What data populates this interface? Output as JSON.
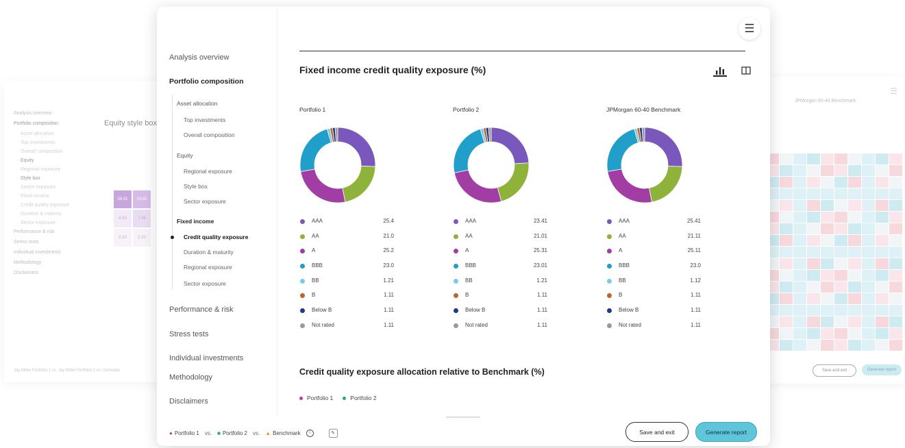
{
  "background_left": {
    "nav": [
      "Analysis overview",
      "Portfolio composition",
      "Asset allocation",
      "Top investments",
      "Overall composition",
      "Equity",
      "Regional exposure",
      "Style box",
      "Sector exposure",
      "Fixed income",
      "Credit quality exposure",
      "Duration & maturity",
      "Sector exposure",
      "Performance & risk",
      "Stress tests",
      "Individual investments",
      "Methodology",
      "Disclaimers"
    ],
    "title": "Equity style box",
    "cells": [
      "26.01",
      "24.92",
      "4.03",
      "7.34",
      "2.20",
      "2.20"
    ],
    "footer": "Jay Miller Portfolio 1  vs.  Jay Miller Portfolio 2  vs.  Generate"
  },
  "background_right": {
    "title": "JPMorgan 60-40 Benchmark",
    "save_label": "Save and exit",
    "generate_label": "Generate report"
  },
  "sidebar": {
    "analysis_overview": "Analysis overview",
    "portfolio_composition": "Portfolio composition",
    "asset_allocation": "Asset allocation",
    "top_investments": "Top investments",
    "overall_composition": "Overall composition",
    "equity": "Equity",
    "regional_exposure": "Regional exposure",
    "style_box": "Style box",
    "sector_exposure_eq": "Sector exposure",
    "fixed_income": "Fixed income",
    "credit_quality_exposure": "Credit quality exposure",
    "duration_maturity": "Duration & maturity",
    "regional_exposure_fi": "Regional exposure",
    "sector_exposure_fi": "Sector exposure",
    "performance_risk": "Performance & risk",
    "stress_tests": "Stress tests",
    "individual_investments": "Individual investments",
    "methodology": "Methodology",
    "disclaimers": "Disclaimers"
  },
  "header": {
    "menu_icon": "hamburger-icon"
  },
  "main": {
    "title": "Fixed income credit quality exposure (%)",
    "second_title": "Credit quality exposure allocation relative to Benchmark (%)",
    "series_legend": [
      {
        "label": "Portfolio 1",
        "color": "#c2399e"
      },
      {
        "label": "Portfolio 2",
        "color": "#17a989"
      }
    ]
  },
  "colors": {
    "AAA": "#7a57bd",
    "AA": "#8fb23a",
    "A": "#a23da6",
    "BBB": "#1f9fc9",
    "BB": "#7ec6ea",
    "B": "#c0622b",
    "Below B": "#1d3c88",
    "Not rated": "#9a9a9a"
  },
  "chart_data": [
    {
      "type": "pie",
      "title": "Portfolio 1",
      "categories": [
        "AAA",
        "AA",
        "A",
        "BBB",
        "BB",
        "B",
        "Below B",
        "Not rated"
      ],
      "values": [
        25.4,
        21.0,
        25.2,
        23.0,
        1.21,
        1.11,
        1.11,
        1.11
      ],
      "value_labels": [
        "25.4",
        "21.0",
        "25.2",
        "23.0",
        "1.21",
        "1.11",
        "1.11",
        "1.11"
      ]
    },
    {
      "type": "pie",
      "title": "Portfolio 2",
      "categories": [
        "AAA",
        "AA",
        "A",
        "BBB",
        "BB",
        "B",
        "Below B",
        "Not rated"
      ],
      "values": [
        23.41,
        21.01,
        25.31,
        23.01,
        1.21,
        1.11,
        1.11,
        1.11
      ],
      "value_labels": [
        "23.41",
        "21.01",
        "25.31",
        "23.01",
        "1.21",
        "1.11",
        "1.11",
        "1.11"
      ]
    },
    {
      "type": "pie",
      "title": "JPMorgan 60-40 Benchmark",
      "categories": [
        "AAA",
        "AA",
        "A",
        "BBB",
        "BB",
        "B",
        "Below B",
        "Not rated"
      ],
      "values": [
        25.41,
        21.11,
        25.11,
        23.0,
        1.12,
        1.11,
        1.11,
        1.11
      ],
      "value_labels": [
        "25.41",
        "21.11",
        "25.11",
        "23.0",
        "1.12",
        "1.11",
        "1.11",
        "1.11"
      ]
    }
  ],
  "footer": {
    "portfolio1": "Portfolio 1",
    "vs1": "vs.",
    "portfolio2": "Portfolio 2",
    "vs2": "vs.",
    "benchmark": "Benchmark",
    "save_label": "Save and exit",
    "generate_label": "Generate report"
  }
}
